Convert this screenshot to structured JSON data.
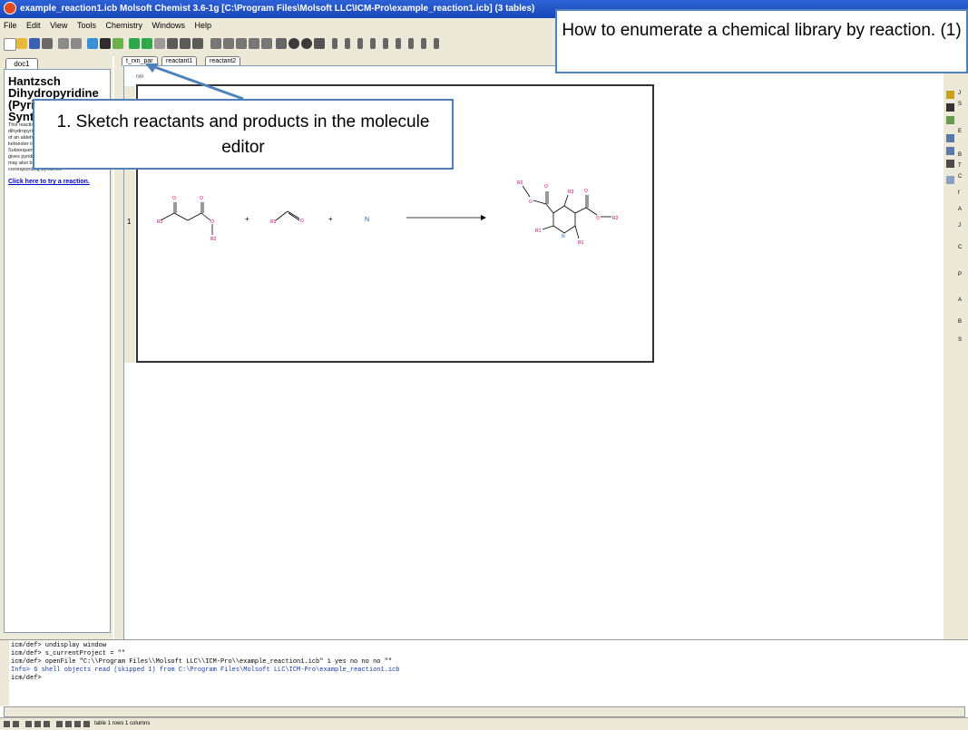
{
  "window": {
    "title": "example_reaction1.icb Molsoft Chemist 3.6-1g [C:\\Program Files\\Molsoft LLC\\ICM-Pro\\example_reaction1.icb] (3 tables)"
  },
  "menu": [
    "File",
    "Edit",
    "View",
    "Tools",
    "Chemistry",
    "Windows",
    "Help"
  ],
  "left_panel": {
    "tab": "doc1",
    "heading": "Hantzsch Dihydropyridine (Pyridine) Synthesis",
    "body": "This reaction allows the preparation of dihydropyridine derivatives by condensation of an aldehyde with two equivalents of a β-ketoester in the presence of ammonia. Subsequent oxidation (or dehydrogenation) gives pyridine-3,5-dicarboxylates, which may also be decarboxylated to yield the corresponding pyridines.",
    "link": "Click here to try a reaction."
  },
  "table_tabs": [
    "t_rxn_par",
    "reactant1",
    "reactant2"
  ],
  "table": {
    "column_header": "rxn",
    "row_number": "1"
  },
  "molecule": {
    "atom_labels": {
      "r1": "R1",
      "o": "O",
      "n": "N",
      "r2": "R2",
      "r3": "R3"
    },
    "plus": "+"
  },
  "right_bar_letters": [
    "J",
    "S",
    "E",
    "B",
    "T",
    "C",
    "f",
    "A",
    "J",
    "C",
    "P",
    "A",
    "B",
    "S"
  ],
  "console": {
    "lines": [
      "icm/def> undisplay window",
      "icm/def> s_currentProject = \"\"",
      "icm/def> openFile \"C:\\\\Program Files\\\\Molsoft LLC\\\\ICM-Pro\\\\example_reaction1.icb\" 1 yes no no no \"\"",
      " Info> 6 shell objects read (skipped 1) from C:\\Program Files\\Molsoft LLC\\ICM-Pro\\example_reaction1.icb",
      "icm/def> "
    ]
  },
  "status": {
    "text": "table 1 rows 1 columns"
  },
  "callouts": {
    "title": "How to enumerate a chemical library by reaction. (1)",
    "step1": "1. Sketch reactants and products in the molecule editor"
  },
  "colors": {
    "callout_border": "#4f81bd",
    "titlebar": "#2d62d6",
    "chrome": "#ece9d8",
    "oxygen": "#e0007a",
    "nitrogen": "#2050d0",
    "r_group": "#b0006a"
  }
}
